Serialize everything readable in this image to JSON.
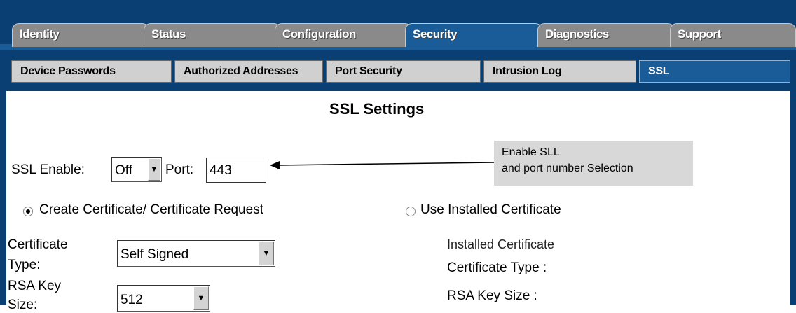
{
  "tabs": [
    {
      "label": "Identity",
      "active": false
    },
    {
      "label": "Status",
      "active": false
    },
    {
      "label": "Configuration",
      "active": false
    },
    {
      "label": "Security",
      "active": true
    },
    {
      "label": "Diagnostics",
      "active": false
    },
    {
      "label": "Support",
      "active": false
    }
  ],
  "subtabs": [
    {
      "label": "Device Passwords",
      "active": false
    },
    {
      "label": "Authorized Addresses",
      "active": false
    },
    {
      "label": "Port Security",
      "active": false
    },
    {
      "label": "Intrusion Log",
      "active": false
    },
    {
      "label": "SSL",
      "active": true
    }
  ],
  "page": {
    "title": "SSL Settings",
    "ssl_enable_label": "SSL Enable:",
    "ssl_enable_value": "Off",
    "port_label": "Port:",
    "port_value": "443",
    "create_cert_label": "Create Certificate/ Certificate Request",
    "use_installed_label": "Use Installed Certificate",
    "cert_type_label_1": "Certificate",
    "cert_type_label_2": "Type:",
    "cert_type_value": "Self Signed",
    "rsa_label_1": "RSA Key",
    "rsa_label_2": "Size:",
    "rsa_value": "512",
    "installed_heading": "Installed Certificate",
    "installed_cert_type": "Certificate Type :",
    "installed_rsa_size": "RSA Key Size :"
  },
  "callout": {
    "line1": "Enable SLL",
    "line2": "and port number Selection"
  },
  "colors": {
    "frame": "#0a3f73",
    "active_tab": "#1a5c98",
    "inactive_tab": "#8a8a8a",
    "subtab": "#d0d0d0"
  }
}
